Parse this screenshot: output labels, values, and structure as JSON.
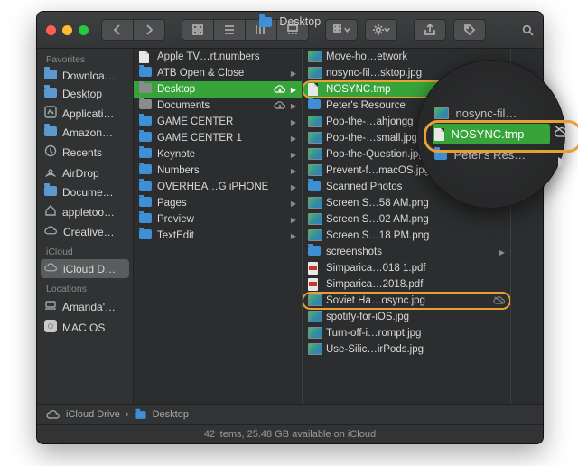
{
  "window": {
    "title": "Desktop"
  },
  "toolbar": {
    "search_placeholder": "Search"
  },
  "sidebar": {
    "sections": [
      {
        "title": "Favorites",
        "items": [
          {
            "label": "Downloa…",
            "icon": "folder"
          },
          {
            "label": "Desktop",
            "icon": "folder"
          },
          {
            "label": "Applicati…",
            "icon": "app"
          },
          {
            "label": "Amazon…",
            "icon": "folder"
          },
          {
            "label": "Recents",
            "icon": "clock"
          },
          {
            "label": "AirDrop",
            "icon": "airdrop"
          },
          {
            "label": "Docume…",
            "icon": "folder"
          },
          {
            "label": "appletoo…",
            "icon": "home"
          },
          {
            "label": "Creative…",
            "icon": "cloud-alt"
          }
        ]
      },
      {
        "title": "iCloud",
        "items": [
          {
            "label": "iCloud D…",
            "icon": "cloud",
            "selected": true
          }
        ]
      },
      {
        "title": "Locations",
        "items": [
          {
            "label": "Amanda'…",
            "icon": "laptop"
          },
          {
            "label": "MAC OS",
            "icon": "disk"
          }
        ]
      }
    ]
  },
  "columns": [
    {
      "items": [
        {
          "label": "Apple TV…rt.numbers",
          "icon": "doc",
          "expand": false
        },
        {
          "label": "ATB Open & Close",
          "icon": "folder",
          "expand": true
        },
        {
          "label": "Desktop",
          "icon": "folder-grey",
          "expand": true,
          "selected": true,
          "cloud": true
        },
        {
          "label": "Documents",
          "icon": "folder-grey",
          "expand": true,
          "cloud": true
        },
        {
          "label": "GAME CENTER",
          "icon": "folder",
          "expand": true
        },
        {
          "label": "GAME CENTER 1",
          "icon": "folder",
          "expand": true
        },
        {
          "label": "Keynote",
          "icon": "folder",
          "expand": true
        },
        {
          "label": "Numbers",
          "icon": "folder",
          "expand": true
        },
        {
          "label": "OVERHEA…G iPHONE",
          "icon": "folder",
          "expand": true
        },
        {
          "label": "Pages",
          "icon": "folder",
          "expand": true
        },
        {
          "label": "Preview",
          "icon": "folder",
          "expand": true
        },
        {
          "label": "TextEdit",
          "icon": "folder",
          "expand": true
        }
      ]
    },
    {
      "items": [
        {
          "label": "Move-ho…etwork",
          "icon": "img"
        },
        {
          "label": "nosync-fil…sktop.jpg",
          "icon": "img"
        },
        {
          "label": "NOSYNC.tmp",
          "icon": "doc",
          "selected": true,
          "highlight": true
        },
        {
          "label": "Peter's Resource",
          "icon": "folder",
          "expand": true
        },
        {
          "label": "Pop-the-…ahjongg",
          "icon": "img"
        },
        {
          "label": "Pop-the-…small.jpg",
          "icon": "img"
        },
        {
          "label": "Pop-the-Question.jpg",
          "icon": "img"
        },
        {
          "label": "Prevent-f…macOS.jpg",
          "icon": "img"
        },
        {
          "label": "Scanned Photos",
          "icon": "folder",
          "expand": true
        },
        {
          "label": "Screen S…58 AM.png",
          "icon": "img"
        },
        {
          "label": "Screen S…02 AM.png",
          "icon": "img"
        },
        {
          "label": "Screen S…18 PM.png",
          "icon": "img"
        },
        {
          "label": "screenshots",
          "icon": "folder",
          "expand": true
        },
        {
          "label": "Simparica…018 1.pdf",
          "icon": "pdf"
        },
        {
          "label": "Simparica…2018.pdf",
          "icon": "pdf"
        },
        {
          "label": "Soviet Ha…osync.jpg",
          "icon": "img",
          "highlight": true,
          "nosync": true
        },
        {
          "label": "spotify-for-iOS.jpg",
          "icon": "img"
        },
        {
          "label": "Turn-off-i…rompt.jpg",
          "icon": "img"
        },
        {
          "label": "Use-Silic…irPods.jpg",
          "icon": "img"
        }
      ]
    }
  ],
  "pathbar": {
    "segments": [
      "iCloud Drive",
      "Desktop"
    ]
  },
  "status": {
    "text": "42 items, 25.48 GB available on iCloud"
  },
  "magnifier": {
    "line_above": "nosync-fil…",
    "selected": "NOSYNC.tmp",
    "line_below": "Peter's Res…"
  }
}
